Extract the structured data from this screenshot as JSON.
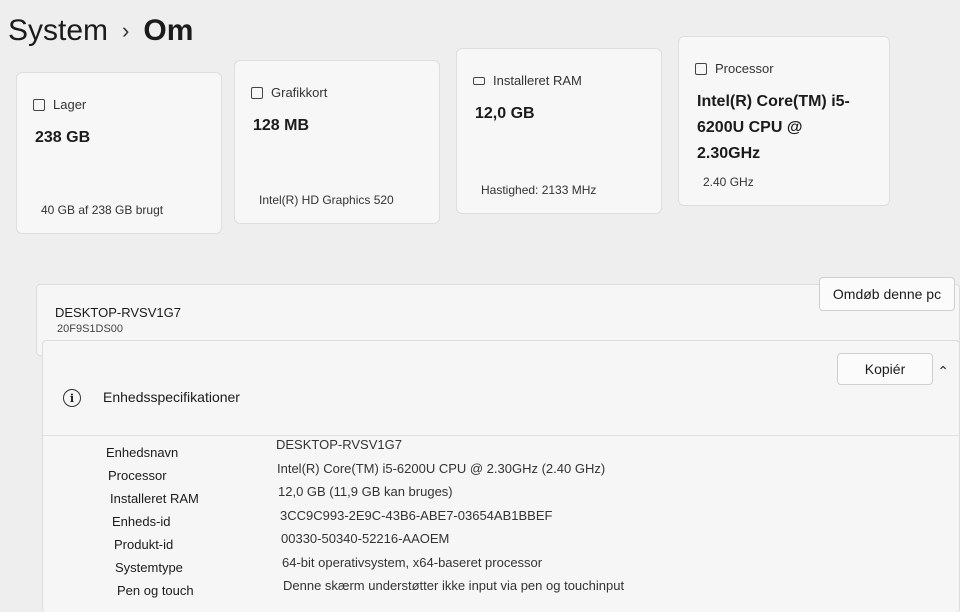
{
  "breadcrumb": {
    "parent": "System",
    "current": "Om"
  },
  "cards": [
    {
      "icon": "storage-icon",
      "label": "Lager",
      "value": "238 GB",
      "sub": "40 GB af 238 GB brugt"
    },
    {
      "icon": "gpu-icon",
      "label": "Grafikkort",
      "value": "128 MB",
      "sub": "Intel(R) HD Graphics 520"
    },
    {
      "icon": "ram-icon",
      "label": "Installeret RAM",
      "value": "12,0 GB",
      "sub": "Hastighed: 2133 MHz"
    },
    {
      "icon": "cpu-icon",
      "label": "Processor",
      "value": "Intel(R) Core(TM) i5-6200U CPU @ 2.30GHz",
      "sub": "2.40 GHz"
    }
  ],
  "device": {
    "name": "DESKTOP-RVSV1G7",
    "model": "20F9S1DS00",
    "rename_label": "Omdøb denne pc"
  },
  "specs": {
    "title": "Enhedsspecifikationer",
    "copy_label": "Kopiér",
    "rows": [
      {
        "key": "Enhedsnavn",
        "value": "DESKTOP-RVSV1G7"
      },
      {
        "key": "Processor",
        "value": "Intel(R) Core(TM) i5-6200U CPU @ 2.30GHz (2.40 GHz)"
      },
      {
        "key": "Installeret RAM",
        "value": "12,0 GB (11,9 GB kan bruges)"
      },
      {
        "key": "Enheds-id",
        "value": "3CC9C993-2E9C-43B6-ABE7-03654AB1BBEF"
      },
      {
        "key": "Produkt-id",
        "value": "00330-50340-52216-AAOEM"
      },
      {
        "key": "Systemtype",
        "value": "64-bit operativsystem, x64-baseret processor"
      },
      {
        "key": "Pen og touch",
        "value": "Denne skærm understøtter ikke input via pen og touchinput"
      }
    ]
  }
}
